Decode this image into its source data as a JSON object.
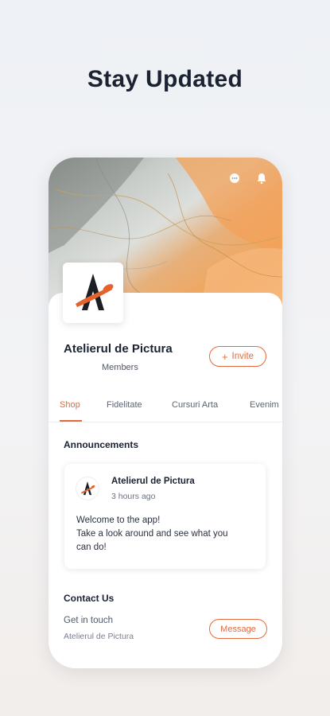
{
  "promo": {
    "title": "Stay Updated"
  },
  "site": {
    "name": "Atelierul de Pictura",
    "members_label": "Members"
  },
  "header": {
    "icons": [
      "chat-icon",
      "bell-icon"
    ]
  },
  "invite": {
    "label": "Invite",
    "icon": "plus-icon"
  },
  "tabs": [
    {
      "label": "Shop",
      "active": true
    },
    {
      "label": "Fidelitate",
      "active": false
    },
    {
      "label": "Cursuri Arta",
      "active": false
    },
    {
      "label": "Evenim",
      "active": false
    }
  ],
  "announcements": {
    "title": "Announcements",
    "post": {
      "author": "Atelierul de Pictura",
      "time": "3 hours ago",
      "lines": [
        "Welcome to the app!",
        "Take a look around and see what you",
        "can do!"
      ]
    }
  },
  "contact": {
    "title": "Contact Us",
    "label": "Get in touch",
    "sub": "Atelierul de Pictura",
    "button": "Message"
  },
  "colors": {
    "accent": "#e46a3c",
    "logo_orange": "#e4632c",
    "text_dark": "#1b2231"
  }
}
